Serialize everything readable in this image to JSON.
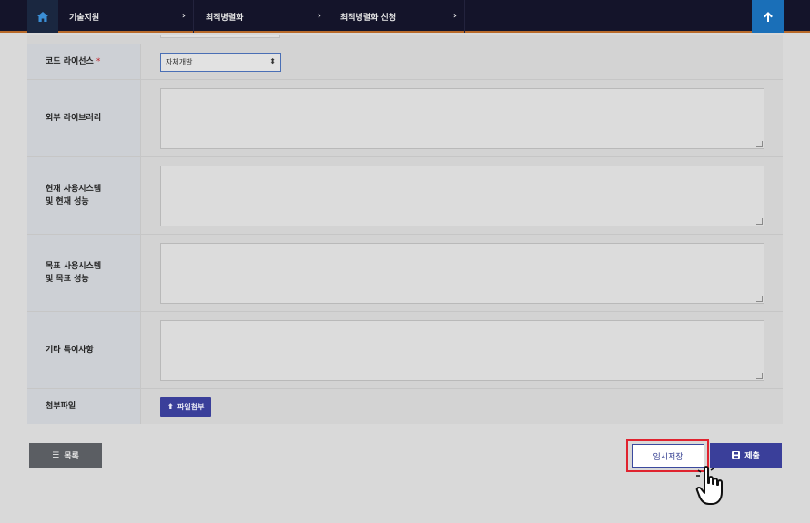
{
  "nav": {
    "home_icon": "home-icon",
    "items": [
      {
        "label": "기술지원"
      },
      {
        "label": "최적병렬화"
      },
      {
        "label": "최적병렬화 신청"
      }
    ],
    "top_icon": "arrow-up-icon"
  },
  "form": {
    "license": {
      "label": "코드 라이선스",
      "required_mark": "*",
      "select_value": "자체개발"
    },
    "external_lib": {
      "label": "외부 라이브러리"
    },
    "current_system": {
      "label_line1": "현재 사용시스템",
      "label_line2": "및 현재 성능"
    },
    "target_system": {
      "label_line1": "목표 사용시스템",
      "label_line2": "및 목표 성능"
    },
    "etc": {
      "label": "기타 특이사항"
    },
    "attachment": {
      "label": "첨부파일",
      "button_label": "파일첨부"
    }
  },
  "actions": {
    "list_label": "목록",
    "temp_save_label": "임시저장",
    "submit_label": "제출"
  },
  "colors": {
    "nav_bg": "#14142a",
    "accent_blue": "#3a3f9a",
    "top_btn": "#1a6fb8",
    "highlight_red": "#e0232f",
    "required_red": "#c0262d"
  }
}
